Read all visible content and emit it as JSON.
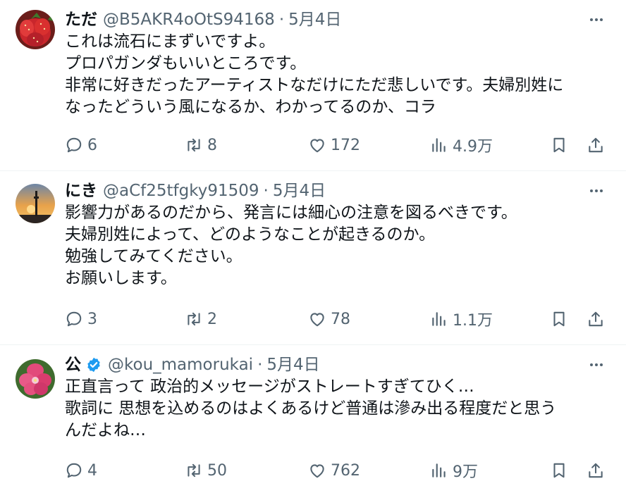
{
  "posts": [
    {
      "name": "ただ",
      "handle": "@B5AKR4oOtS94168",
      "dot": "·",
      "date": "5月4日",
      "verified": false,
      "avatar": "strawberry-avatar",
      "lines": [
        "これは流石にまずいですよ。",
        "プロパガンダもいいところです。",
        "非常に好きだったアーティストなだけにただ悲しいです。夫婦別姓に",
        "なったどういう風になるか、わかってるのか、コラ"
      ],
      "replies": "6",
      "reposts": "8",
      "likes": "172",
      "views": "4.9万"
    },
    {
      "name": "にき",
      "handle": "@aCf25tfgky91509",
      "dot": "·",
      "date": "5月4日",
      "verified": false,
      "avatar": "sunset-tower-avatar",
      "lines": [
        "影響力があるのだから、発言には細心の注意を図るべきです。",
        "夫婦別姓によって、どのようなことが起きるのか。",
        "勉強してみてください。",
        "お願いします。"
      ],
      "replies": "3",
      "reposts": "2",
      "likes": "78",
      "views": "1.1万"
    },
    {
      "name": "公",
      "handle": "@kou_mamorukai",
      "dot": "·",
      "date": "5月4日",
      "verified": true,
      "avatar": "pink-flower-avatar",
      "lines": [
        "正直言って 政治的メッセージがストレートすぎてひく…",
        "歌詞に 思想を込めるのはよくあるけど普通は滲み出る程度だと思う",
        "んだよね…"
      ],
      "replies": "4",
      "reposts": "50",
      "likes": "762",
      "views": "9万"
    }
  ],
  "icons": {
    "more": "more-icon",
    "reply": "reply-icon",
    "repost": "repost-icon",
    "like": "like-icon",
    "views": "views-icon",
    "bookmark": "bookmark-icon",
    "share": "share-icon",
    "verified": "verified-badge-icon"
  },
  "colors": {
    "text": "#0f1419",
    "secondary": "#536471",
    "verified": "#1d9bf0",
    "divider": "#eff3f4"
  }
}
